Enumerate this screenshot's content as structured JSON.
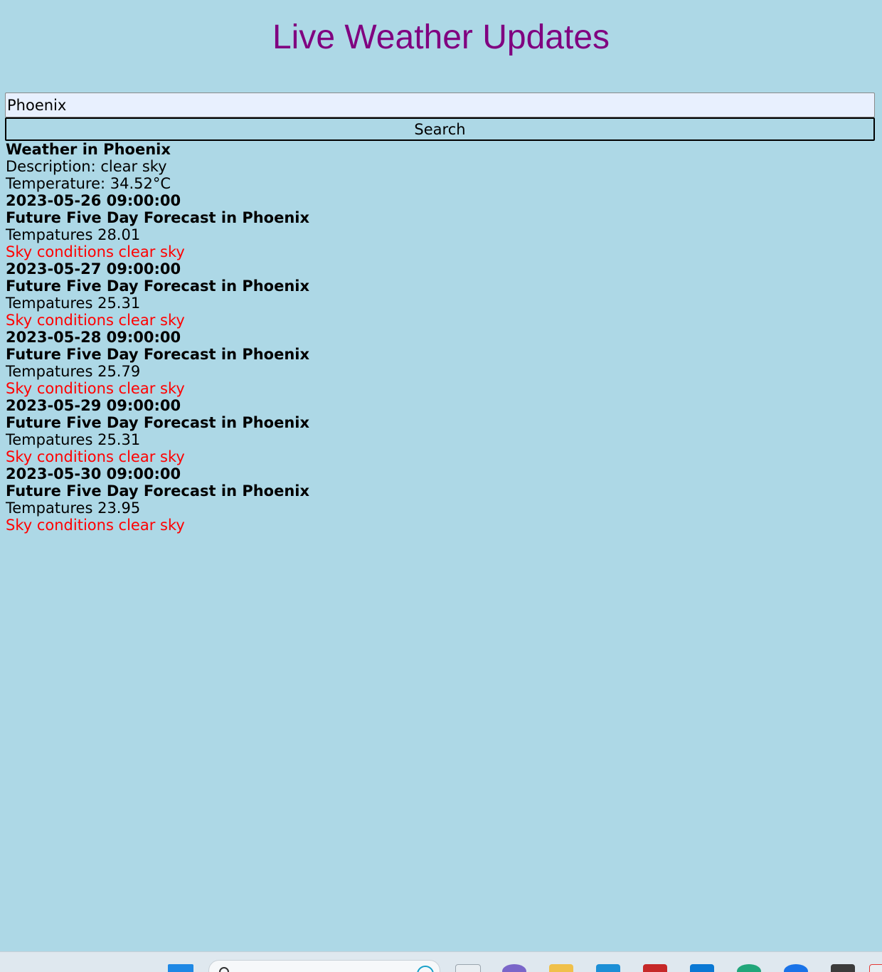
{
  "header": {
    "title": "Live Weather Updates"
  },
  "search": {
    "value": "Phoenix",
    "button_label": "Search"
  },
  "current": {
    "heading": "Weather in Phoenix",
    "description": "Description: clear sky",
    "temperature": "Temperature: 34.52°C"
  },
  "forecast": [
    {
      "datetime": "2023-05-26 09:00:00",
      "heading": "Future Five Day Forecast in Phoenix",
      "temp": "Tempatures 28.01",
      "sky": "Sky conditions clear sky"
    },
    {
      "datetime": "2023-05-27 09:00:00",
      "heading": "Future Five Day Forecast in Phoenix",
      "temp": "Tempatures 25.31",
      "sky": "Sky conditions clear sky"
    },
    {
      "datetime": "2023-05-28 09:00:00",
      "heading": "Future Five Day Forecast in Phoenix",
      "temp": "Tempatures 25.79",
      "sky": "Sky conditions clear sky"
    },
    {
      "datetime": "2023-05-29 09:00:00",
      "heading": "Future Five Day Forecast in Phoenix",
      "temp": "Tempatures 25.31",
      "sky": "Sky conditions clear sky"
    },
    {
      "datetime": "2023-05-30 09:00:00",
      "heading": "Future Five Day Forecast in Phoenix",
      "temp": "Tempatures 23.95",
      "sky": "Sky conditions clear sky"
    }
  ],
  "colors": {
    "background": "#add8e6",
    "title": "#800080",
    "sky_text": "#ff0000",
    "input_background": "#e8f0fe"
  },
  "taskbar": {
    "icons": [
      "windows-start-icon",
      "search-icon",
      "task-view-icon",
      "chat-icon",
      "file-explorer-icon",
      "store-icon",
      "mail-icon",
      "app-icon",
      "edge-icon",
      "app-icon",
      "app-icon",
      "app-icon"
    ]
  }
}
